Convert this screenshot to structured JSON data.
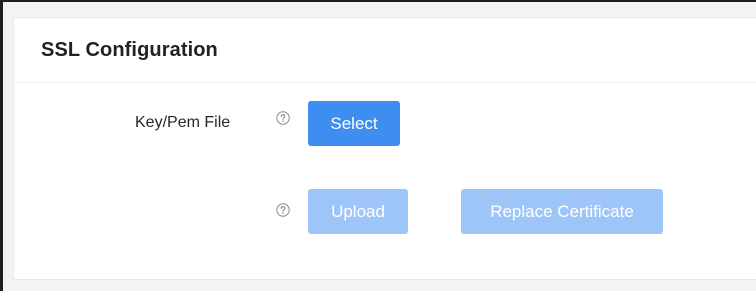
{
  "card": {
    "title": "SSL Configuration"
  },
  "form": {
    "key_pem_label": "Key/Pem File",
    "select_label": "Select",
    "upload_label": "Upload",
    "replace_label": "Replace Certificate"
  },
  "icons": {
    "help": "question-circle-icon"
  },
  "colors": {
    "primary": "#3d8ef0",
    "disabled": "#9ec5f8"
  }
}
